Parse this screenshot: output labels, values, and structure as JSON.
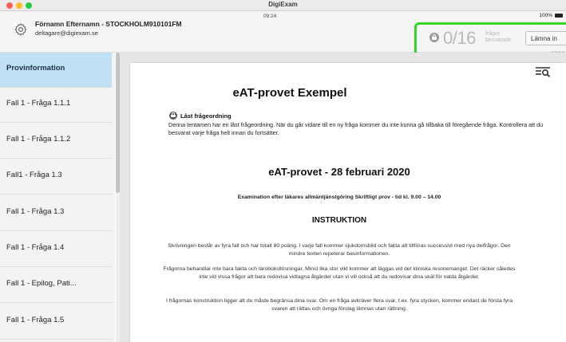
{
  "window": {
    "title": "DigiExam"
  },
  "header": {
    "user_name": "Förnamn Efternamn - STOCKHOLM910101FM",
    "user_email": "deltagare@digiexam.se",
    "time": "09:24",
    "battery": "100%",
    "answered_count": "0/16",
    "answered_label_line1": "frågor",
    "answered_label_line2": "besvarade",
    "submit_label": "Lämna in",
    "version": "v12.9.0"
  },
  "sidebar": {
    "items": [
      {
        "label": "Provinformation",
        "active": true
      },
      {
        "label": "Fall 1 - Fråga 1.1.1"
      },
      {
        "label": "Fall 1 - Fråga 1.1.2"
      },
      {
        "label": "Fall1 - Fråga 1.3"
      },
      {
        "label": "Fall 1 - Fråga 1.3"
      },
      {
        "label": "Fall 1 - Fråga 1.4"
      },
      {
        "label": "Fall 1 - Epilog, Pati..."
      },
      {
        "label": "Fall 1 - Fråga 1.5"
      }
    ]
  },
  "document": {
    "title": "eAT-provet Exempel",
    "locked_heading": "Låst frågeordning",
    "locked_text": "Denna tentamen har en låst frågeordning. När du går vidare till en ny fråga kommer du inte kunna gå tillbaka till föregående fråga. Kontrollera att du besvarat varje fråga helt innan du fortsätter.",
    "subtitle": "eAT-provet - 28 februari 2020",
    "exam_info": "Examination efter läkares allmäntjänstgöring Skriftligt prov - tid kl. 9.00 – 14.00",
    "instruction_heading": "INSTRUKTION",
    "paragraph1": "Skrivningen består av fyra fall och har totalt 80 poäng. I varje fall kommer sjukdomsbild och fakta att tillföras successivt med nya delfrågor. Den mindre texten repeterar basinformationen.",
    "paragraph2": "Frågorna behandlar inte bara fakta och läroboksllösningar. Minst lika stor vikt kommer att läggas vid det kliniska resonemanget. Det räcker således inte vid vissa frågor att bara redovisa vidtagna åtgärder utan vi vill också att du redovisar dina skäl för valda åtgärder.",
    "paragraph3": "I frågornas konstruktion ligger att du måste begränsa dina svar. Om en fråga avkräver flera svar, t.ex. fyra stycken, kommer endast de första fyra svaren att rättas och övriga förslag lämnas utan rättning."
  },
  "colors": {
    "status_highlight": "#35d62b",
    "sidebar_active": "#bfe0f5",
    "counter_gray": "#b9b9b9"
  },
  "icons": [
    "settings-gear-icon",
    "lock-icon",
    "search-list-icon",
    "battery-icon"
  ]
}
